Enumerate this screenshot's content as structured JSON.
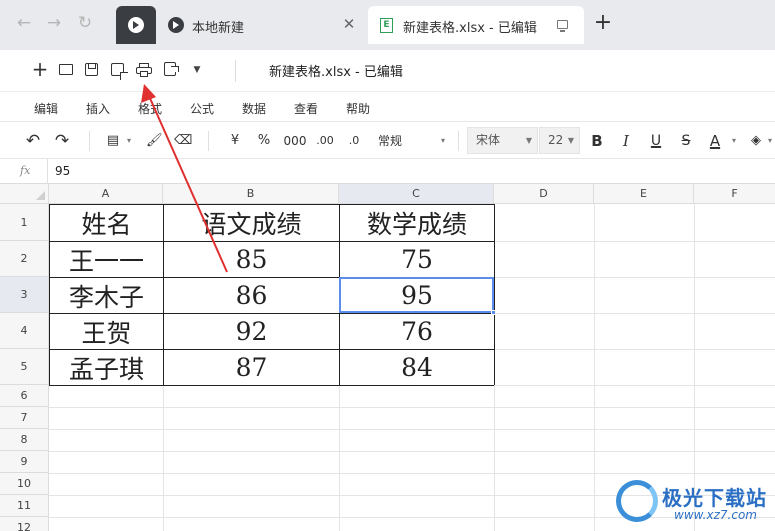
{
  "browser": {
    "tabs": [
      {
        "label": "本地新建"
      },
      {
        "label": "新建表格.xlsx - 已编辑",
        "active": true
      }
    ],
    "file_icon_letter": "E"
  },
  "document": {
    "title": "新建表格.xlsx - 已编辑"
  },
  "menu": {
    "items": [
      "编辑",
      "插入",
      "格式",
      "公式",
      "数据",
      "查看",
      "帮助"
    ]
  },
  "format_toolbar": {
    "currency": "¥",
    "percent": "%",
    "thousands": "000",
    "increase_decimal": ".00",
    "decrease_decimal": ".0",
    "number_format": "常规",
    "font": "宋体",
    "font_size": "22",
    "bold": "B",
    "italic": "I",
    "underline": "U",
    "strikethrough": "S",
    "font_color": "A",
    "font_color_value": "#222222"
  },
  "formula_bar": {
    "label": "fx",
    "value": "95"
  },
  "sheet": {
    "columns": [
      "A",
      "B",
      "C",
      "D",
      "E",
      "F"
    ],
    "rows": [
      "1",
      "2",
      "3",
      "4",
      "5",
      "6",
      "7",
      "8",
      "9",
      "10",
      "11",
      "12"
    ],
    "selected_cell": "C3",
    "table": [
      [
        "姓名",
        "语文成绩",
        "数学成绩"
      ],
      [
        "王一一",
        "85",
        "75"
      ],
      [
        "李木子",
        "86",
        "95"
      ],
      [
        "王贺",
        "92",
        "76"
      ],
      [
        "孟子琪",
        "87",
        "84"
      ]
    ]
  },
  "annotation": {
    "arrow_color": "#e03030"
  },
  "watermark": {
    "title": "极光下载站",
    "url": "www.xz7.com"
  }
}
